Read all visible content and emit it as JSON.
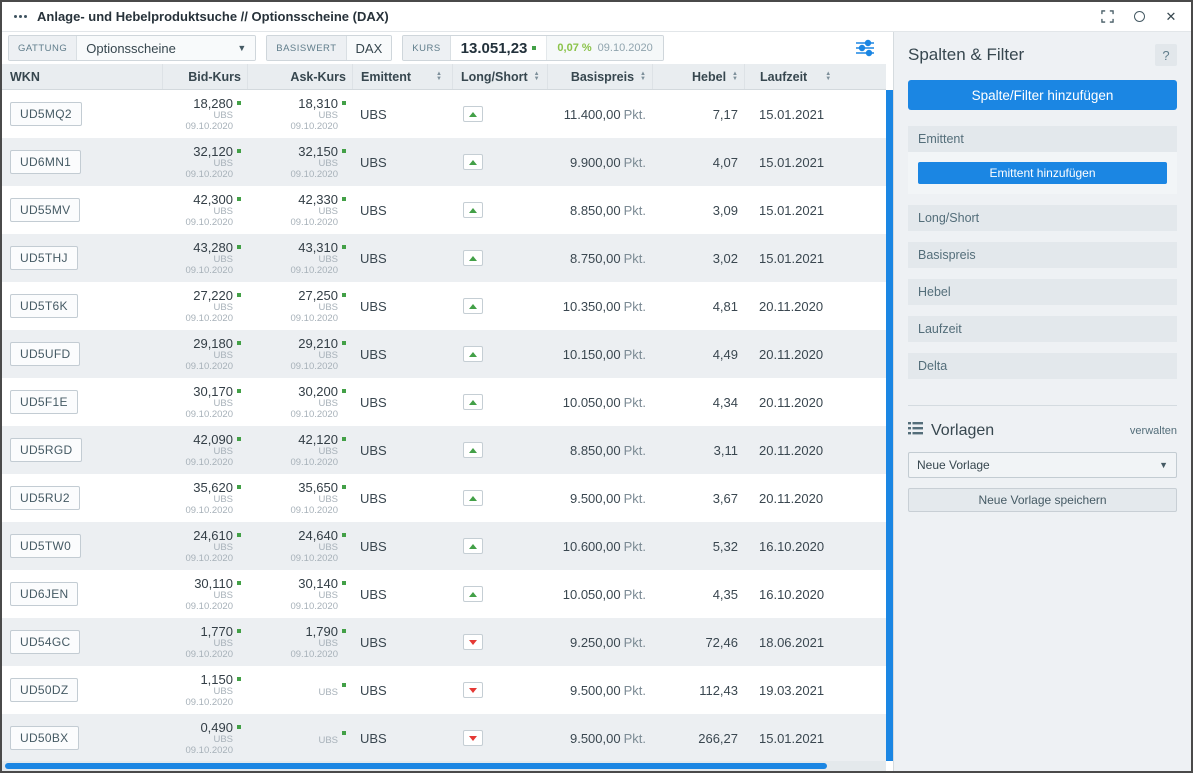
{
  "window": {
    "title": "Anlage- und Hebelproduktsuche // Optionsscheine (DAX)"
  },
  "toolbar": {
    "gattung_label": "GATTUNG",
    "gattung_value": "Optionsscheine",
    "basiswert_label": "BASISWERT",
    "basiswert_value": "DAX",
    "kurs_label": "KURS",
    "kurs_value": "13.051,23",
    "kurs_change": "0,07 %",
    "kurs_date": "09.10.2020"
  },
  "table": {
    "columns": [
      {
        "label": "WKN",
        "sortable": false
      },
      {
        "label": "Bid-Kurs",
        "sortable": false
      },
      {
        "label": "Ask-Kurs",
        "sortable": false
      },
      {
        "label": "Emittent",
        "sortable": true
      },
      {
        "label": "Long/Short",
        "sortable": true
      },
      {
        "label": "Basispreis",
        "sortable": true
      },
      {
        "label": "Hebel",
        "sortable": true
      },
      {
        "label": "Laufzeit",
        "sortable": true
      }
    ],
    "rows": [
      {
        "wkn": "UD5MQ2",
        "bid": "18,280",
        "bid_source": "UBS",
        "bid_date": "09.10.2020",
        "ask": "18,310",
        "ask_source": "UBS",
        "ask_date": "09.10.2020",
        "emittent": "UBS",
        "direction": "long",
        "basispreis": "11.400,00",
        "basispreis_unit": "Pkt.",
        "hebel": "7,17",
        "laufzeit": "15.01.2021"
      },
      {
        "wkn": "UD6MN1",
        "bid": "32,120",
        "bid_source": "UBS",
        "bid_date": "09.10.2020",
        "ask": "32,150",
        "ask_source": "UBS",
        "ask_date": "09.10.2020",
        "emittent": "UBS",
        "direction": "long",
        "basispreis": "9.900,00",
        "basispreis_unit": "Pkt.",
        "hebel": "4,07",
        "laufzeit": "15.01.2021"
      },
      {
        "wkn": "UD55MV",
        "bid": "42,300",
        "bid_source": "UBS",
        "bid_date": "09.10.2020",
        "ask": "42,330",
        "ask_source": "UBS",
        "ask_date": "09.10.2020",
        "emittent": "UBS",
        "direction": "long",
        "basispreis": "8.850,00",
        "basispreis_unit": "Pkt.",
        "hebel": "3,09",
        "laufzeit": "15.01.2021"
      },
      {
        "wkn": "UD5THJ",
        "bid": "43,280",
        "bid_source": "UBS",
        "bid_date": "09.10.2020",
        "ask": "43,310",
        "ask_source": "UBS",
        "ask_date": "09.10.2020",
        "emittent": "UBS",
        "direction": "long",
        "basispreis": "8.750,00",
        "basispreis_unit": "Pkt.",
        "hebel": "3,02",
        "laufzeit": "15.01.2021"
      },
      {
        "wkn": "UD5T6K",
        "bid": "27,220",
        "bid_source": "UBS",
        "bid_date": "09.10.2020",
        "ask": "27,250",
        "ask_source": "UBS",
        "ask_date": "09.10.2020",
        "emittent": "UBS",
        "direction": "long",
        "basispreis": "10.350,00",
        "basispreis_unit": "Pkt.",
        "hebel": "4,81",
        "laufzeit": "20.11.2020"
      },
      {
        "wkn": "UD5UFD",
        "bid": "29,180",
        "bid_source": "UBS",
        "bid_date": "09.10.2020",
        "ask": "29,210",
        "ask_source": "UBS",
        "ask_date": "09.10.2020",
        "emittent": "UBS",
        "direction": "long",
        "basispreis": "10.150,00",
        "basispreis_unit": "Pkt.",
        "hebel": "4,49",
        "laufzeit": "20.11.2020"
      },
      {
        "wkn": "UD5F1E",
        "bid": "30,170",
        "bid_source": "UBS",
        "bid_date": "09.10.2020",
        "ask": "30,200",
        "ask_source": "UBS",
        "ask_date": "09.10.2020",
        "emittent": "UBS",
        "direction": "long",
        "basispreis": "10.050,00",
        "basispreis_unit": "Pkt.",
        "hebel": "4,34",
        "laufzeit": "20.11.2020"
      },
      {
        "wkn": "UD5RGD",
        "bid": "42,090",
        "bid_source": "UBS",
        "bid_date": "09.10.2020",
        "ask": "42,120",
        "ask_source": "UBS",
        "ask_date": "09.10.2020",
        "emittent": "UBS",
        "direction": "long",
        "basispreis": "8.850,00",
        "basispreis_unit": "Pkt.",
        "hebel": "3,11",
        "laufzeit": "20.11.2020"
      },
      {
        "wkn": "UD5RU2",
        "bid": "35,620",
        "bid_source": "UBS",
        "bid_date": "09.10.2020",
        "ask": "35,650",
        "ask_source": "UBS",
        "ask_date": "09.10.2020",
        "emittent": "UBS",
        "direction": "long",
        "basispreis": "9.500,00",
        "basispreis_unit": "Pkt.",
        "hebel": "3,67",
        "laufzeit": "20.11.2020"
      },
      {
        "wkn": "UD5TW0",
        "bid": "24,610",
        "bid_source": "UBS",
        "bid_date": "09.10.2020",
        "ask": "24,640",
        "ask_source": "UBS",
        "ask_date": "09.10.2020",
        "emittent": "UBS",
        "direction": "long",
        "basispreis": "10.600,00",
        "basispreis_unit": "Pkt.",
        "hebel": "5,32",
        "laufzeit": "16.10.2020"
      },
      {
        "wkn": "UD6JEN",
        "bid": "30,110",
        "bid_source": "UBS",
        "bid_date": "09.10.2020",
        "ask": "30,140",
        "ask_source": "UBS",
        "ask_date": "09.10.2020",
        "emittent": "UBS",
        "direction": "long",
        "basispreis": "10.050,00",
        "basispreis_unit": "Pkt.",
        "hebel": "4,35",
        "laufzeit": "16.10.2020"
      },
      {
        "wkn": "UD54GC",
        "bid": "1,770",
        "bid_source": "UBS",
        "bid_date": "09.10.2020",
        "ask": "1,790",
        "ask_source": "UBS",
        "ask_date": "09.10.2020",
        "emittent": "UBS",
        "direction": "short",
        "basispreis": "9.250,00",
        "basispreis_unit": "Pkt.",
        "hebel": "72,46",
        "laufzeit": "18.06.2021"
      },
      {
        "wkn": "UD50DZ",
        "bid": "1,150",
        "bid_source": "UBS",
        "bid_date": "09.10.2020",
        "ask": "",
        "ask_source": "UBS",
        "ask_date": "",
        "emittent": "UBS",
        "direction": "short",
        "basispreis": "9.500,00",
        "basispreis_unit": "Pkt.",
        "hebel": "112,43",
        "laufzeit": "19.03.2021"
      },
      {
        "wkn": "UD50BX",
        "bid": "0,490",
        "bid_source": "UBS",
        "bid_date": "09.10.2020",
        "ask": "",
        "ask_source": "UBS",
        "ask_date": "",
        "emittent": "UBS",
        "direction": "short",
        "basispreis": "9.500,00",
        "basispreis_unit": "Pkt.",
        "hebel": "266,27",
        "laufzeit": "15.01.2021"
      }
    ]
  },
  "sidebar": {
    "title": "Spalten & Filter",
    "help_label": "?",
    "add_button": "Spalte/Filter hinzufügen",
    "filters": [
      "Emittent",
      "Long/Short",
      "Basispreis",
      "Hebel",
      "Laufzeit",
      "Delta"
    ],
    "emittent_add_button": "Emittent hinzufügen",
    "vorlagen": {
      "title": "Vorlagen",
      "manage_label": "verwalten",
      "selected": "Neue Vorlage",
      "save_button": "Neue Vorlage speichern"
    }
  },
  "colors": {
    "accent": "#1b86e3",
    "green": "#43a047",
    "red": "#e53935",
    "chg-green": "#8bc34a"
  }
}
